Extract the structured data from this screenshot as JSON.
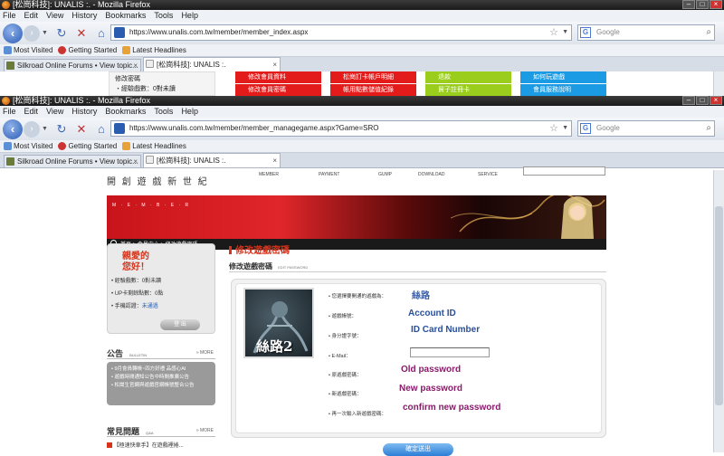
{
  "win1": {
    "title": "[松崗科技]: UNALIS :. - Mozilla Firefox",
    "menu": [
      "File",
      "Edit",
      "View",
      "History",
      "Bookmarks",
      "Tools",
      "Help"
    ],
    "url": "https://www.unalis.com.tw/member/member_index.aspx",
    "search_placeholder": "Google",
    "bookmarks": [
      "Most Visited",
      "Getting Started",
      "Latest Headlines"
    ],
    "tabs": [
      "Silkroad Online Forums • View topic...",
      "[松崗科技]: UNALIS :."
    ],
    "left_items": [
      "修改密碼",
      "・經驗戲數：0對未讀"
    ],
    "menu_tiles": [
      {
        "label": "修改會員資料",
        "color": "#e31b1b"
      },
      {
        "label": "修改會員密碼",
        "color": "#e31b1b"
      },
      {
        "label": "松崗訂卡帳戶明細",
        "color": "#e31b1b"
      },
      {
        "label": "帳用點數儲值紀錄",
        "color": "#e31b1b"
      },
      {
        "label": "退款",
        "color": "#9acd1c"
      },
      {
        "label": "貿子註冊卡",
        "color": "#9acd1c"
      },
      {
        "label": "如何玩遊戲",
        "color": "#1a9be3"
      },
      {
        "label": "會員服務說明",
        "color": "#1a9be3"
      }
    ]
  },
  "win2": {
    "title": "[松崗科技]: UNALIS :. - Mozilla Firefox",
    "menu": [
      "File",
      "Edit",
      "View",
      "History",
      "Bookmarks",
      "Tools",
      "Help"
    ],
    "url": "https://www.unalis.com.tw/member/member_managegame.aspx?Game=SRO",
    "search_placeholder": "Google",
    "bookmarks": [
      "Most Visited",
      "Getting Started",
      "Latest Headlines"
    ],
    "tabs": [
      "Silkroad Online Forums • View topic...",
      "[松崗科技]: UNALIS :."
    ]
  },
  "site": {
    "slogan": "開 創 遊 戲 新 世 紀",
    "nav": [
      "MEMBER",
      "PAYMENT",
      "GUMP",
      "DOWNLOAD",
      "SERVICE"
    ],
    "banner_letters": "M · E · M · B · E · R",
    "breadcrumb": "首頁 > 會員中心 > 修改遊戲密碼",
    "greeting_line1": "親愛的",
    "greeting_line2": "您好！",
    "member_info": [
      "經驗戲數：0對未讀",
      "UP卡剩餘點數：0點",
      "手機認證："
    ],
    "verify_link": "未通過",
    "logout": "登 出",
    "bulletin_title": "公告",
    "bulletin_sub": "BULLETIN",
    "more": "» MORE",
    "bulletin_items": [
      "9月會員轉帳~四方好禮 品感心AI",
      "遊戲時間通知公告中時間推廣公告",
      "松崗生官網與遊戲官網帳號整合公告"
    ],
    "faq_title": "常見問題",
    "faq_sub": "Q&A",
    "faq_item": "【極速快車手】在遊戲裡捲...",
    "section_title": "修改遊戲密碼",
    "sub_title": "修改遊戲密碼",
    "sub_title_en": "EDIT PASSWORD",
    "game_logo_text": "絲路2",
    "form_labels": [
      "您選擇要開通的遊戲為：",
      "遊戲帳號：",
      "身分證字號：",
      "E-Mail：",
      "原遊戲密碼：",
      "新遊戲密碼：",
      "再一次輸入新遊戲密碼："
    ],
    "game_name": "絲路",
    "account_note": "Account ID",
    "id_note": "ID Card Number",
    "old_pw_note": "Old password",
    "new_pw_note": "New password",
    "confirm_pw_note": "confirm new password",
    "submit": "確定送出"
  }
}
